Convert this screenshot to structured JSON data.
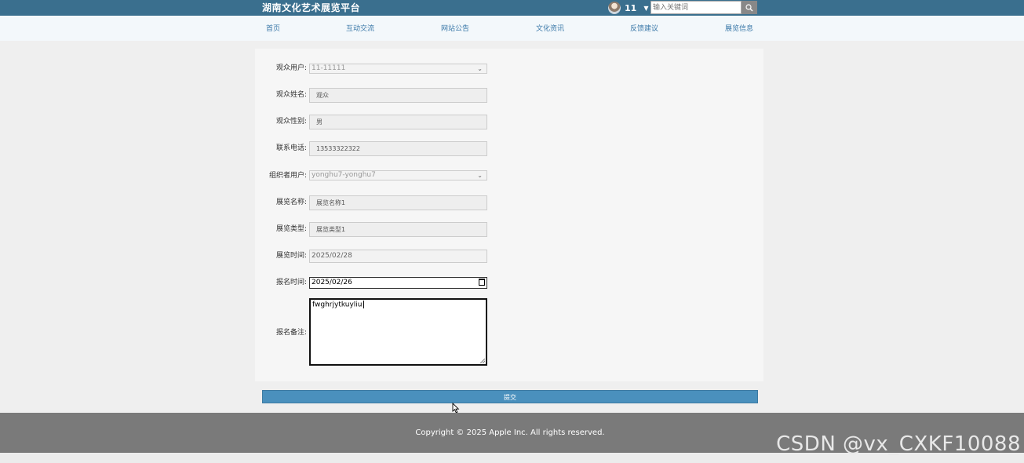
{
  "header": {
    "brand": "湖南文化艺术展览平台",
    "username": "11",
    "search_placeholder": "输入关键词"
  },
  "nav": [
    "首页",
    "互动交流",
    "网站公告",
    "文化资讯",
    "反馈建议",
    "展览信息"
  ],
  "form": {
    "fields": [
      {
        "label": "观众用户:",
        "value": "11-11111",
        "kind": "select"
      },
      {
        "label": "观众姓名:",
        "value": "观众",
        "kind": "input"
      },
      {
        "label": "观众性别:",
        "value": "男",
        "kind": "input"
      },
      {
        "label": "联系电话:",
        "value": "13533322322",
        "kind": "input"
      },
      {
        "label": "组织者用户:",
        "value": "yonghu7-yonghu7",
        "kind": "select"
      },
      {
        "label": "展览名称:",
        "value": "展览名称1",
        "kind": "input"
      },
      {
        "label": "展览类型:",
        "value": "展览类型1",
        "kind": "input"
      },
      {
        "label": "展览时间:",
        "value": "2025/02/28",
        "kind": "disabled"
      },
      {
        "label": "报名时间:",
        "value": "2025/02/26",
        "kind": "date"
      },
      {
        "label": "报名备注:",
        "value": "fwghrjytkuyliu",
        "kind": "textarea"
      }
    ],
    "submit_label": "提交"
  },
  "footer": {
    "copyright": "Copyright © 2025 Apple Inc. All rights reserved."
  },
  "watermark": "CSDN @vx_CXKF10088"
}
